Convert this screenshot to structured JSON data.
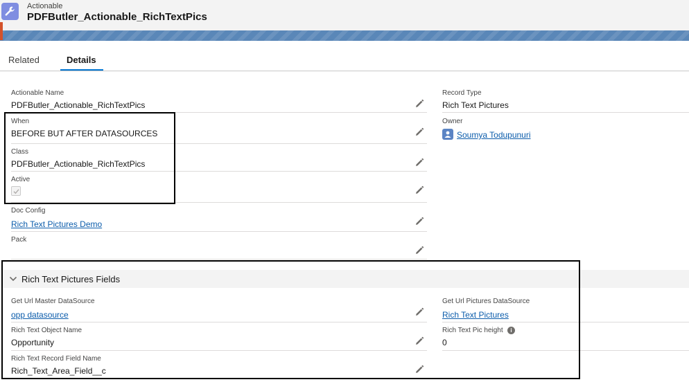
{
  "header": {
    "object_label": "Actionable",
    "record_title": "PDFButler_Actionable_RichTextPics",
    "icon": "wrench-icon"
  },
  "tabs": [
    {
      "label": "Related",
      "active": false
    },
    {
      "label": "Details",
      "active": true
    }
  ],
  "details": {
    "actionable_name": {
      "label": "Actionable Name",
      "value": "PDFButler_Actionable_RichTextPics"
    },
    "when": {
      "label": "When",
      "value": "BEFORE BUT AFTER DATASOURCES"
    },
    "class": {
      "label": "Class",
      "value": "PDFButler_Actionable_RichTextPics"
    },
    "active": {
      "label": "Active",
      "checked": true
    },
    "doc_config": {
      "label": "Doc Config",
      "value": "Rich Text Pictures Demo"
    },
    "pack": {
      "label": "Pack",
      "value": ""
    },
    "record_type": {
      "label": "Record Type",
      "value": "Rich Text Pictures"
    },
    "owner": {
      "label": "Owner",
      "value": "Soumya Todupunuri"
    }
  },
  "section": {
    "title": "Rich Text Pictures Fields",
    "get_url_master": {
      "label": "Get Url Master DataSource",
      "value": "opp datasource"
    },
    "rich_text_object_name": {
      "label": "Rich Text Object Name",
      "value": "Opportunity"
    },
    "rich_text_record_field_name": {
      "label": "Rich Text Record Field Name",
      "value": "Rich_Text_Area_Field__c"
    },
    "get_url_pictures": {
      "label": "Get Url Pictures DataSource",
      "value": "Rich Text Pictures"
    },
    "rich_text_pic_height": {
      "label": "Rich Text Pic height",
      "value": "0"
    }
  },
  "colors": {
    "link": "#0b5cab",
    "tab_active_underline": "#0176d3",
    "object_icon_bg": "#7f8de1",
    "banner": "#5a87b8",
    "highlight_border": "#000000"
  }
}
